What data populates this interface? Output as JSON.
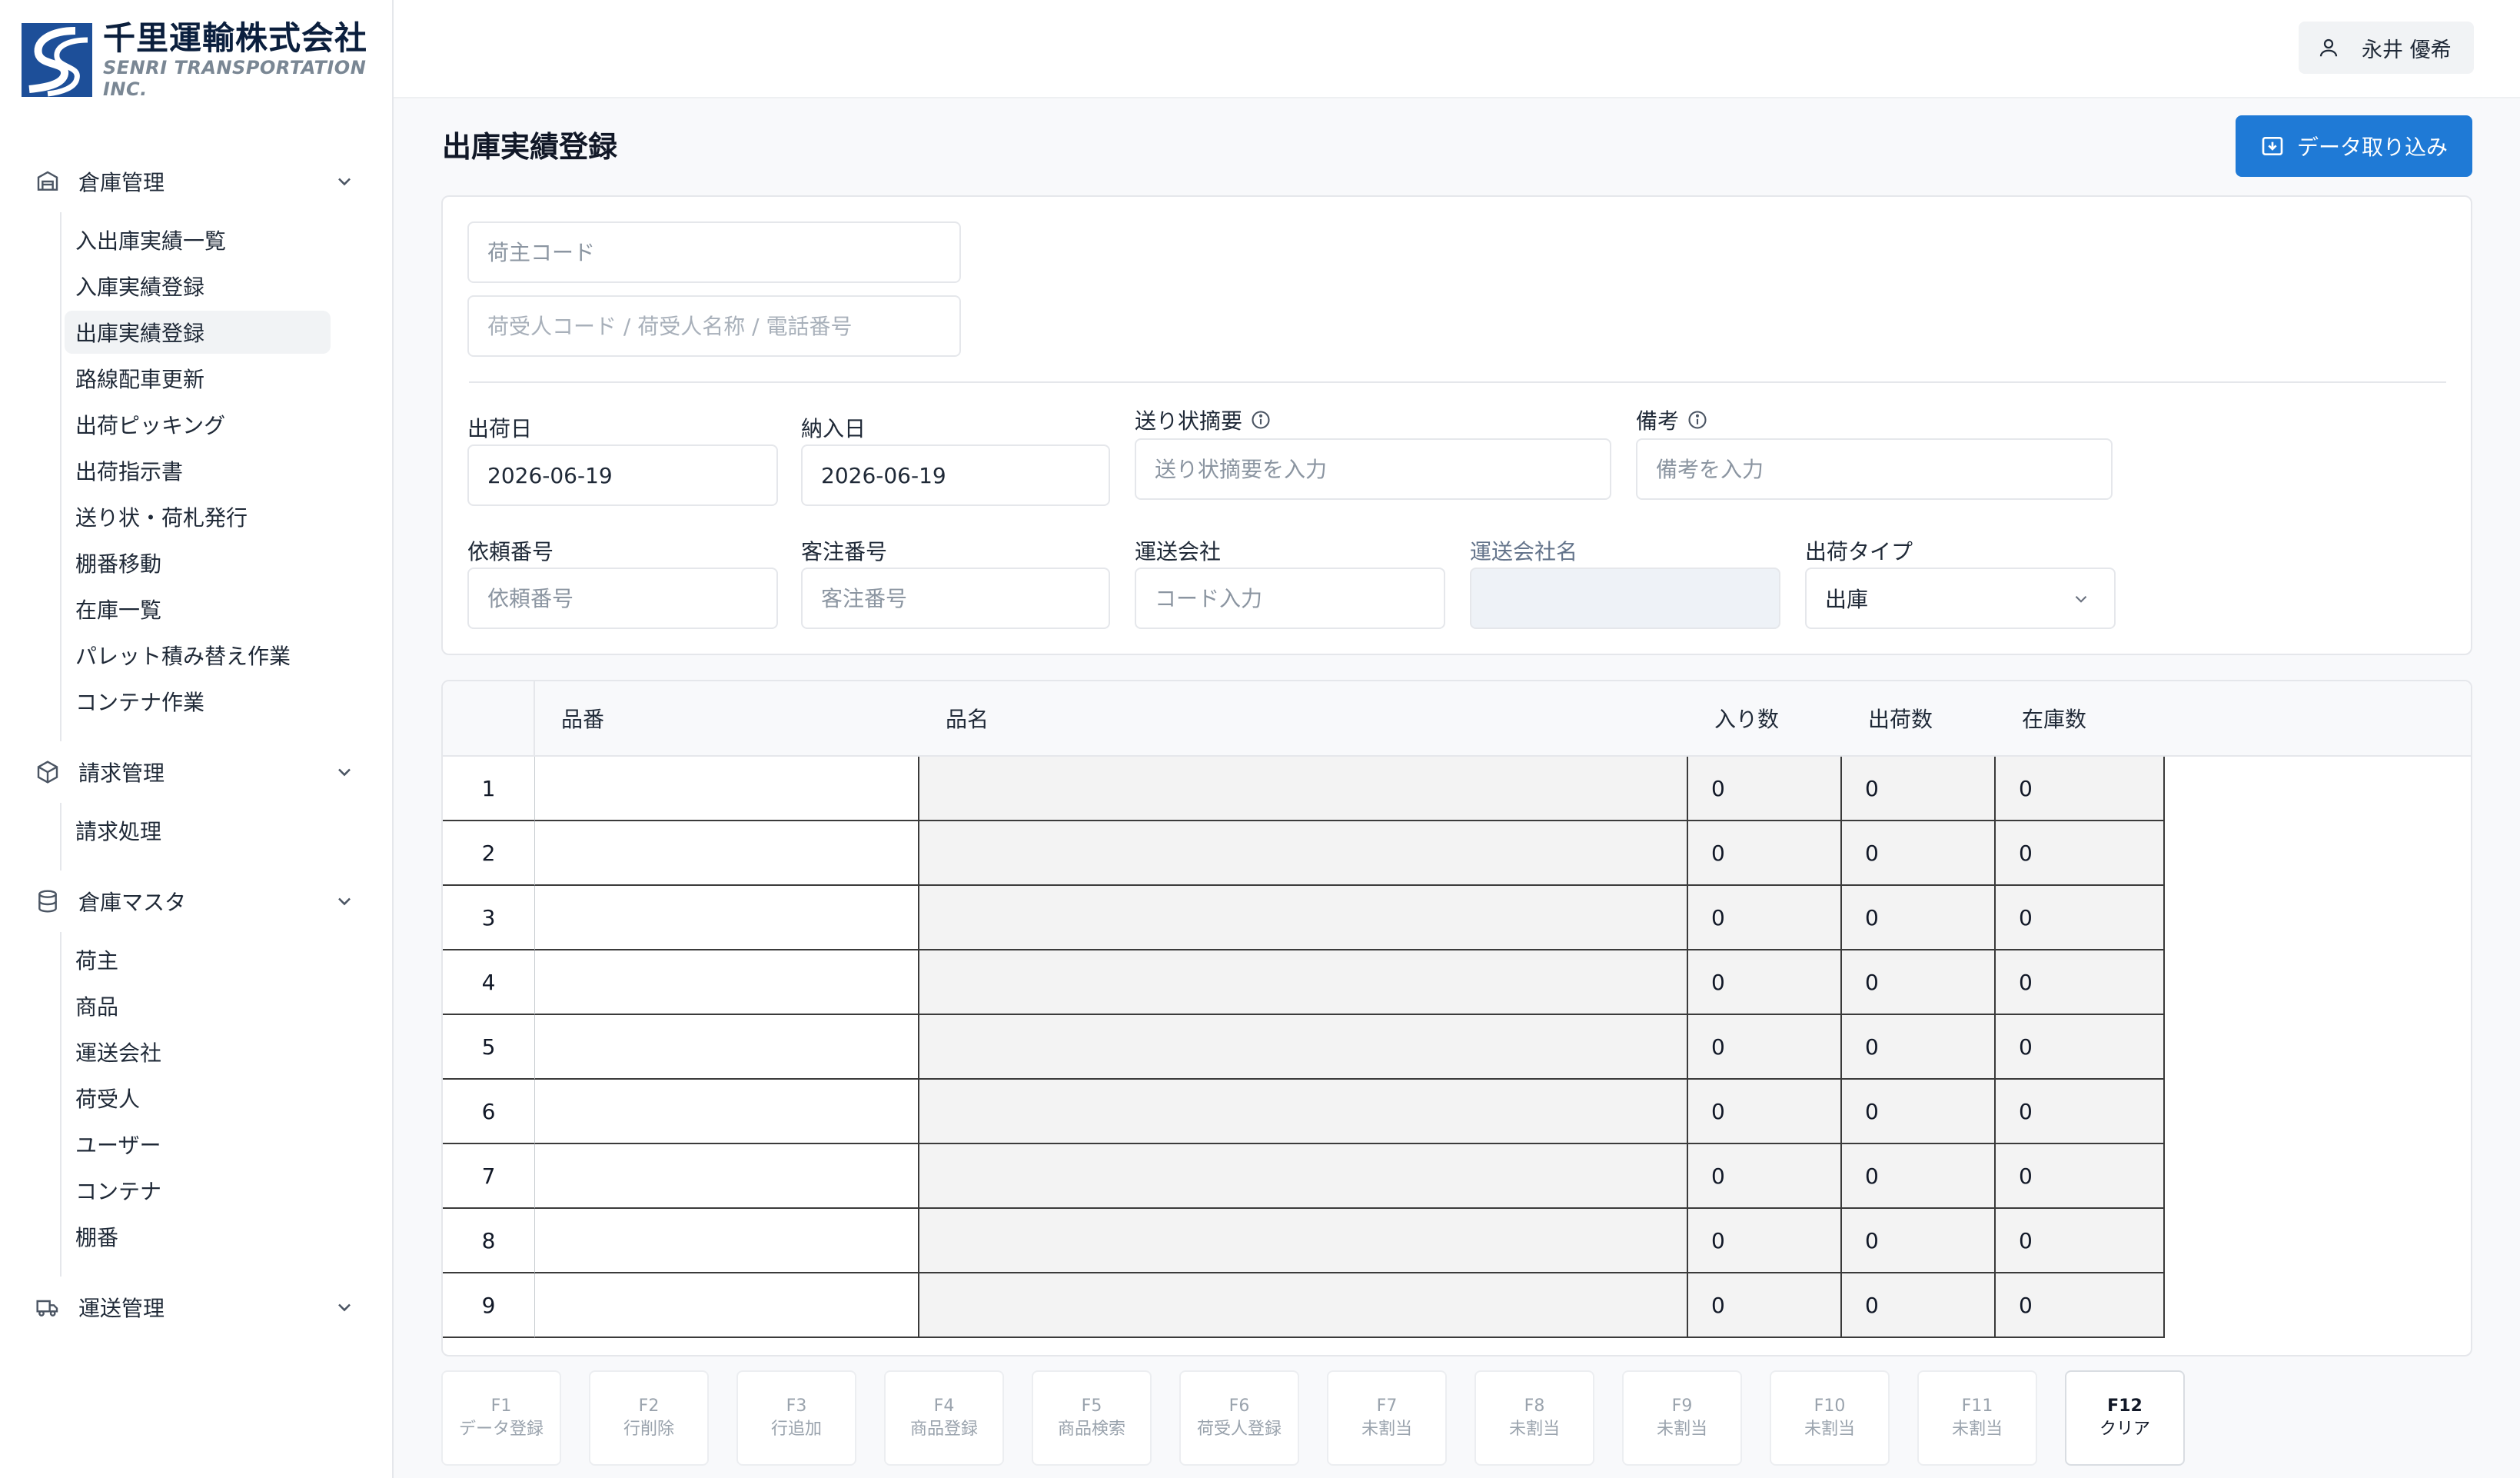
{
  "brand": {
    "name_jp": "千里運輸株式会社",
    "name_en": "SENRI TRANSPORTATION INC.",
    "color": "#1d4f99"
  },
  "user": {
    "name": "永井 優希",
    "icon": "user-icon"
  },
  "sidebar": {
    "groups": [
      {
        "label": "倉庫管理",
        "icon": "warehouse-icon",
        "items": [
          "入出庫実績一覧",
          "入庫実績登録",
          "出庫実績登録",
          "路線配車更新",
          "出荷ピッキング",
          "出荷指示書",
          "送り状・荷札発行",
          "棚番移動",
          "在庫一覧",
          "パレット積み替え作業",
          "コンテナ作業"
        ]
      },
      {
        "label": "請求管理",
        "icon": "box-icon",
        "items": [
          "請求処理"
        ]
      },
      {
        "label": "倉庫マスタ",
        "icon": "database-icon",
        "items": [
          "荷主",
          "商品",
          "運送会社",
          "荷受人",
          "ユーザー",
          "コンテナ",
          "棚番"
        ]
      },
      {
        "label": "運送管理",
        "icon": "truck-icon",
        "items": []
      }
    ],
    "active_item": "出庫実績登録"
  },
  "page": {
    "title": "出庫実績登録",
    "import_button": "データ取り込み",
    "accent": "#1f7ad6"
  },
  "form": {
    "shipper_code": {
      "placeholder": "荷主コード"
    },
    "consignee_search": {
      "placeholder": "荷受人コード / 荷受人名称 / 電話番号"
    },
    "ship_date": {
      "label": "出荷日",
      "value": "2026-06-19"
    },
    "delivery_date": {
      "label": "納入日",
      "value": "2026-06-19"
    },
    "waybill_summary": {
      "label": "送り状摘要",
      "placeholder": "送り状摘要を入力"
    },
    "remarks": {
      "label": "備考",
      "placeholder": "備考を入力"
    },
    "request_no": {
      "label": "依頼番号",
      "placeholder": "依頼番号"
    },
    "customer_order_no": {
      "label": "客注番号",
      "placeholder": "客注番号"
    },
    "carrier": {
      "label": "運送会社",
      "placeholder": "コード入力"
    },
    "carrier_name": {
      "label": "運送会社名",
      "value": ""
    },
    "shipment_type": {
      "label": "出荷タイプ",
      "value": "出庫"
    }
  },
  "table": {
    "columns": [
      "品番",
      "品名",
      "入り数",
      "出荷数",
      "在庫数"
    ],
    "rows": [
      {
        "n": "1",
        "code": "",
        "name": "",
        "qty_per": "0",
        "ship_qty": "0",
        "stock": "0"
      },
      {
        "n": "2",
        "code": "",
        "name": "",
        "qty_per": "0",
        "ship_qty": "0",
        "stock": "0"
      },
      {
        "n": "3",
        "code": "",
        "name": "",
        "qty_per": "0",
        "ship_qty": "0",
        "stock": "0"
      },
      {
        "n": "4",
        "code": "",
        "name": "",
        "qty_per": "0",
        "ship_qty": "0",
        "stock": "0"
      },
      {
        "n": "5",
        "code": "",
        "name": "",
        "qty_per": "0",
        "ship_qty": "0",
        "stock": "0"
      },
      {
        "n": "6",
        "code": "",
        "name": "",
        "qty_per": "0",
        "ship_qty": "0",
        "stock": "0"
      },
      {
        "n": "7",
        "code": "",
        "name": "",
        "qty_per": "0",
        "ship_qty": "0",
        "stock": "0"
      },
      {
        "n": "8",
        "code": "",
        "name": "",
        "qty_per": "0",
        "ship_qty": "0",
        "stock": "0"
      },
      {
        "n": "9",
        "code": "",
        "name": "",
        "qty_per": "0",
        "ship_qty": "0",
        "stock": "0"
      }
    ]
  },
  "fkeys": [
    {
      "key": "F1",
      "label": "データ登録",
      "enabled": false
    },
    {
      "key": "F2",
      "label": "行削除",
      "enabled": false
    },
    {
      "key": "F3",
      "label": "行追加",
      "enabled": false
    },
    {
      "key": "F4",
      "label": "商品登録",
      "enabled": false
    },
    {
      "key": "F5",
      "label": "商品検索",
      "enabled": false
    },
    {
      "key": "F6",
      "label": "荷受人登録",
      "enabled": false
    },
    {
      "key": "F7",
      "label": "未割当",
      "enabled": false
    },
    {
      "key": "F8",
      "label": "未割当",
      "enabled": false
    },
    {
      "key": "F9",
      "label": "未割当",
      "enabled": false
    },
    {
      "key": "F10",
      "label": "未割当",
      "enabled": false
    },
    {
      "key": "F11",
      "label": "未割当",
      "enabled": false
    },
    {
      "key": "F12",
      "label": "クリア",
      "enabled": true
    }
  ]
}
